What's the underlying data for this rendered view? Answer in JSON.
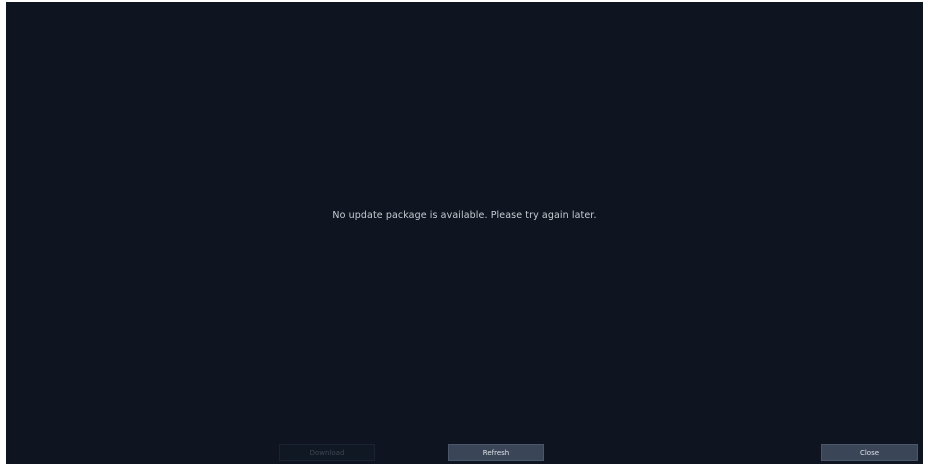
{
  "dialog": {
    "message": "No update package is available. Please try again later."
  },
  "buttons": {
    "download_label": "Download",
    "refresh_label": "Refresh",
    "close_label": "Close"
  },
  "colors": {
    "background": "#0e1520",
    "button": "#3a4658",
    "text": "#c7ccd3"
  }
}
